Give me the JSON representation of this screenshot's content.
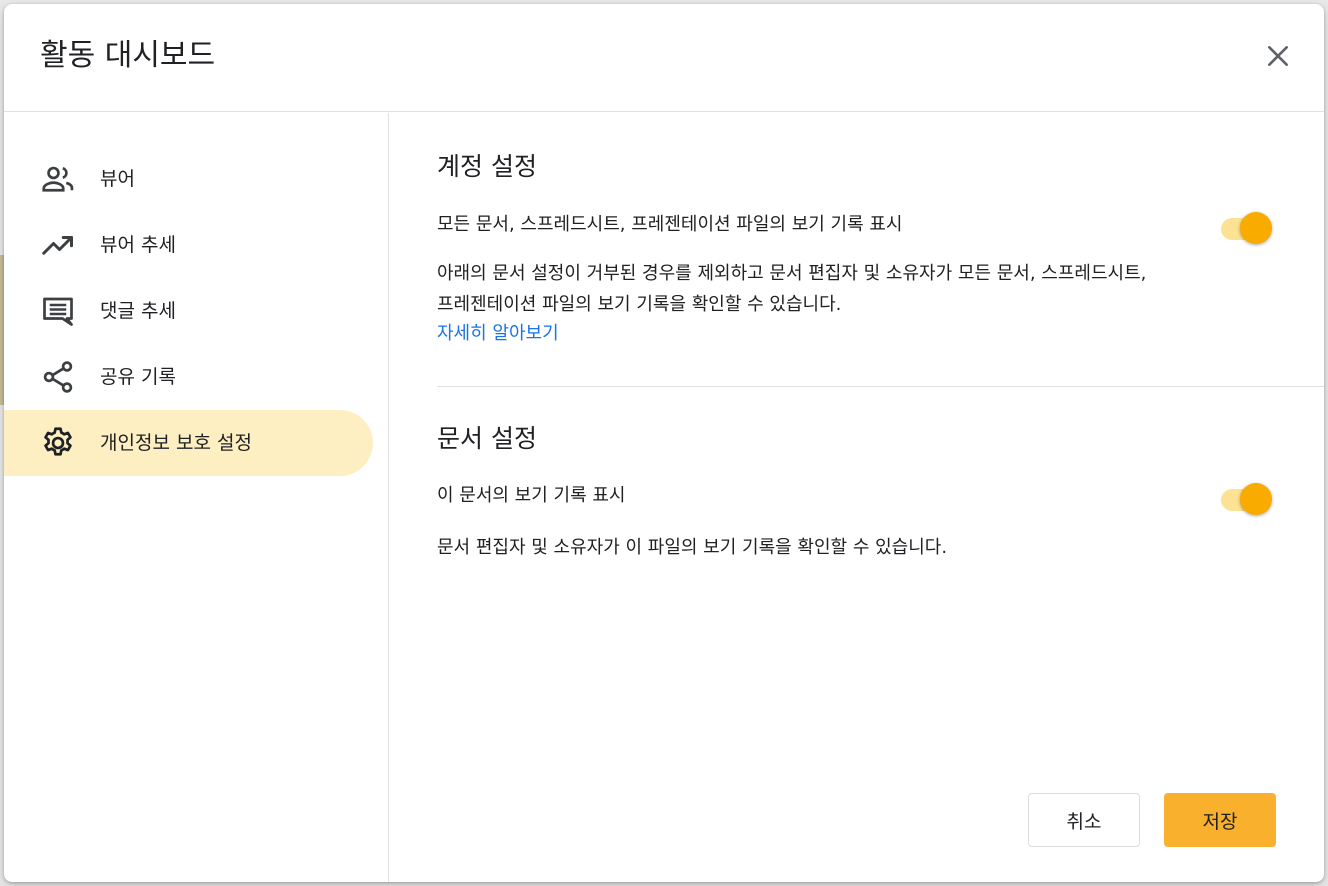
{
  "dialog": {
    "title": "활동 대시보드",
    "close_icon": "close-icon"
  },
  "sidebar": {
    "items": [
      {
        "label": "뷰어",
        "icon": "people-icon",
        "active": false
      },
      {
        "label": "뷰어 추세",
        "icon": "trending-up-icon",
        "active": false
      },
      {
        "label": "댓글 추세",
        "icon": "comment-icon",
        "active": false
      },
      {
        "label": "공유 기록",
        "icon": "share-icon",
        "active": false
      },
      {
        "label": "개인정보 보호 설정",
        "icon": "gear-icon",
        "active": true
      }
    ]
  },
  "account_settings": {
    "title": "계정 설정",
    "toggle_label": "모든 문서, 스프레드시트, 프레젠테이션 파일의 보기 기록 표시",
    "toggle_on": true,
    "description": "아래의 문서 설정이 거부된 경우를 제외하고 문서 편집자 및 소유자가 모든 문서, 스프레드시트, 프레젠테이션 파일의 보기 기록을 확인할 수 있습니다.",
    "learn_more": "자세히 알아보기"
  },
  "document_settings": {
    "title": "문서 설정",
    "toggle_label": "이 문서의 보기 기록 표시",
    "toggle_on": true,
    "description": "문서 편집자 및 소유자가 이 파일의 보기 기록을 확인할 수 있습니다."
  },
  "footer": {
    "cancel_label": "취소",
    "save_label": "저장"
  },
  "colors": {
    "accent": "#f9ab00",
    "active_nav_bg": "#feefc3",
    "link": "#1a73e8",
    "save_button": "#f9b02c"
  }
}
